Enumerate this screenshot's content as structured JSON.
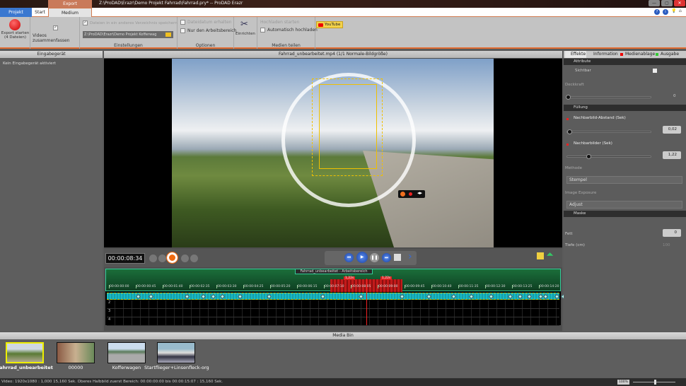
{
  "window": {
    "title": "Z:\\ProDAD\\Erazr\\Demo Projekt Fahrrad\\Fahrrad.pry* -- ProDAD Erazr",
    "context_tab": "Export",
    "min": "—",
    "max": "▢",
    "close": "✕"
  },
  "tabs": [
    {
      "label": "Projekt"
    },
    {
      "label": "Start"
    },
    {
      "label": "Medium exportieren"
    }
  ],
  "help_icons": [
    "?",
    "i",
    "💡",
    "⌂"
  ],
  "ribbon": {
    "export_button": "Export starten\n(4 Dateien)",
    "merge_videos": {
      "label": "Videos zusammenfassen",
      "checked": true
    },
    "save_other_dir": {
      "label": "Dateien in ein anderes Verzeichnis speichern",
      "checked": true
    },
    "path": "Z:\\ProDAD\\Erazr\\Demo Projekt Kofferwag",
    "group_settings": "Einstellungen",
    "keep_date": {
      "label": "Dateidatum erhalten",
      "checked": false
    },
    "work_area_only": {
      "label": "Nur den Arbeitsbereich",
      "checked": false
    },
    "setup": "Einrichten",
    "group_options": "Optionen",
    "start_upload": "Hochladen starten",
    "auto_upload": {
      "label": "Automatisch hochladen",
      "checked": false
    },
    "youtube": "YouTube",
    "group_share": "Medien teilen"
  },
  "left_panel": {
    "header": "Eingabegerät",
    "message": "Kein Eingabegerät aktiviert"
  },
  "preview": {
    "header": "Fahrrad_unbearbeitet.mp4  (1/1  Normale-Bildgröße)"
  },
  "controls": {
    "timecode": "00:00:08:34"
  },
  "timeline": {
    "clip_label": "Fahrrad_unbearbeitet - Arbeitsbereich",
    "ticks": [
      "00:00:00:00",
      "00:00:00:45",
      "00:00:01:40",
      "00:00:02:35",
      "00:00:03:30",
      "00:00:04:25",
      "00:00:05:20",
      "00:00:06:15",
      "00:00:07:10",
      "00:00:08:05",
      "00:00:09:00",
      "00:00:09:45",
      "00:00:10:40",
      "00:00:11:35",
      "00:00:12:30",
      "00:00:13:25",
      "00:00:14:20"
    ],
    "red_labels": [
      "1,22s",
      "1,22s"
    ],
    "tracks": [
      "2",
      "3",
      "4"
    ]
  },
  "right_panel": {
    "tabs": [
      "Effekte",
      "Information",
      "Medienablage",
      "Ausgabe"
    ],
    "attribute": "Attribute",
    "visible": "Sichtbar",
    "opacity": "Deckkraft",
    "opacity_value": "0",
    "fill": "Füllung",
    "afterimage_distance": "Nachbarbild-Abstand (Sek)",
    "afterimage_distance_value": "0,02",
    "afterimages": "Nachbarbilder (Sek)",
    "afterimages_value": "1,22",
    "method": "Methode",
    "method_value": "Stempel",
    "image_exposure": "Image Exposure",
    "exposure_value": "Adjust",
    "mask": "Maske",
    "bold": "Fett",
    "bold_value": "0",
    "depth": "Tiefe (cm)",
    "depth_value": "100"
  },
  "media_bin": {
    "header": "Media Bin",
    "items": [
      {
        "label": "Fahrrad_unbearbeitet",
        "selected": true
      },
      {
        "label": "00000"
      },
      {
        "label": "Kofferwagen"
      },
      {
        "label": "Startflieger+Linsenfleck-org"
      }
    ]
  },
  "status": {
    "text": "Video: 1920x1080 : 1,000  15,160 Sek.  Oberes Halbbild zuerst  Bereich: 00:00:00:00 bis 00:00:15:07 : 15,160 Sek.",
    "zoom": "100%"
  },
  "colors": {
    "accent": "#e06a30",
    "timeline_green": "#1b6e3a",
    "track_cyan": "#19b8c4",
    "playhead": "#e22222"
  }
}
